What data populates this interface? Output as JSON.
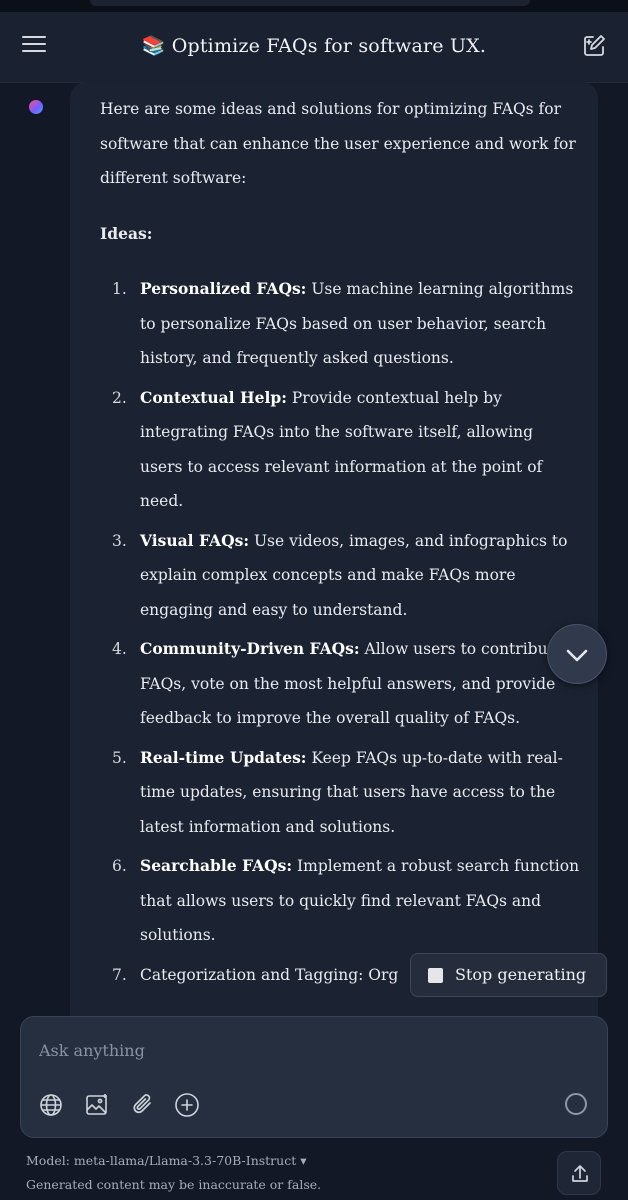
{
  "header": {
    "title_emoji": "📚",
    "title": "Optimize FAQs for software UX."
  },
  "message": {
    "intro": "Here are some ideas and solutions for optimizing FAQs for software that can enhance the user experience and work for different software:",
    "ideas_heading": "Ideas:",
    "items": [
      {
        "num": "1.",
        "title": "Personalized FAQs:",
        "text": " Use machine learning algorithms to personalize FAQs based on user behavior, search history, and frequently asked questions."
      },
      {
        "num": "2.",
        "title": "Contextual Help:",
        "text": " Provide contextual help by integrating FAQs into the software itself, allowing users to access relevant information at the point of need."
      },
      {
        "num": "3.",
        "title": "Visual FAQs:",
        "text": " Use videos, images, and infographics to explain complex concepts and make FAQs more engaging and easy to understand."
      },
      {
        "num": "4.",
        "title": "Community-Driven FAQs:",
        "text": " Allow users to contribute FAQs, vote on the most helpful answers, and provide feedback to improve the overall quality of FAQs."
      },
      {
        "num": "5.",
        "title": "Real-time Updates:",
        "text": " Keep FAQs up-to-date with real-time updates, ensuring that users have access to the latest information and solutions."
      },
      {
        "num": "6.",
        "title": "Searchable FAQs:",
        "text": " Implement a robust search function that allows users to quickly find relevant FAQs and solutions."
      },
      {
        "num": "7.",
        "title": "",
        "text": "Categorization and Tagging: Org"
      }
    ]
  },
  "controls": {
    "stop_label": "Stop generating"
  },
  "composer": {
    "placeholder": "Ask anything"
  },
  "footer": {
    "model_label": "Model: meta-llama/Llama-3.3-70B-Instruct",
    "model_caret": "▾",
    "disclaimer": "Generated content may be inaccurate or false."
  },
  "icons": {
    "menu": "hamburger-menu-icon",
    "new_chat": "new-chat-icon",
    "scroll_down": "chevron-down-icon",
    "web": "globe-icon",
    "image": "image-generate-icon",
    "attach": "paperclip-icon",
    "add": "plus-circle-icon",
    "loading": "loading-spinner-icon",
    "share": "share-upload-icon"
  }
}
